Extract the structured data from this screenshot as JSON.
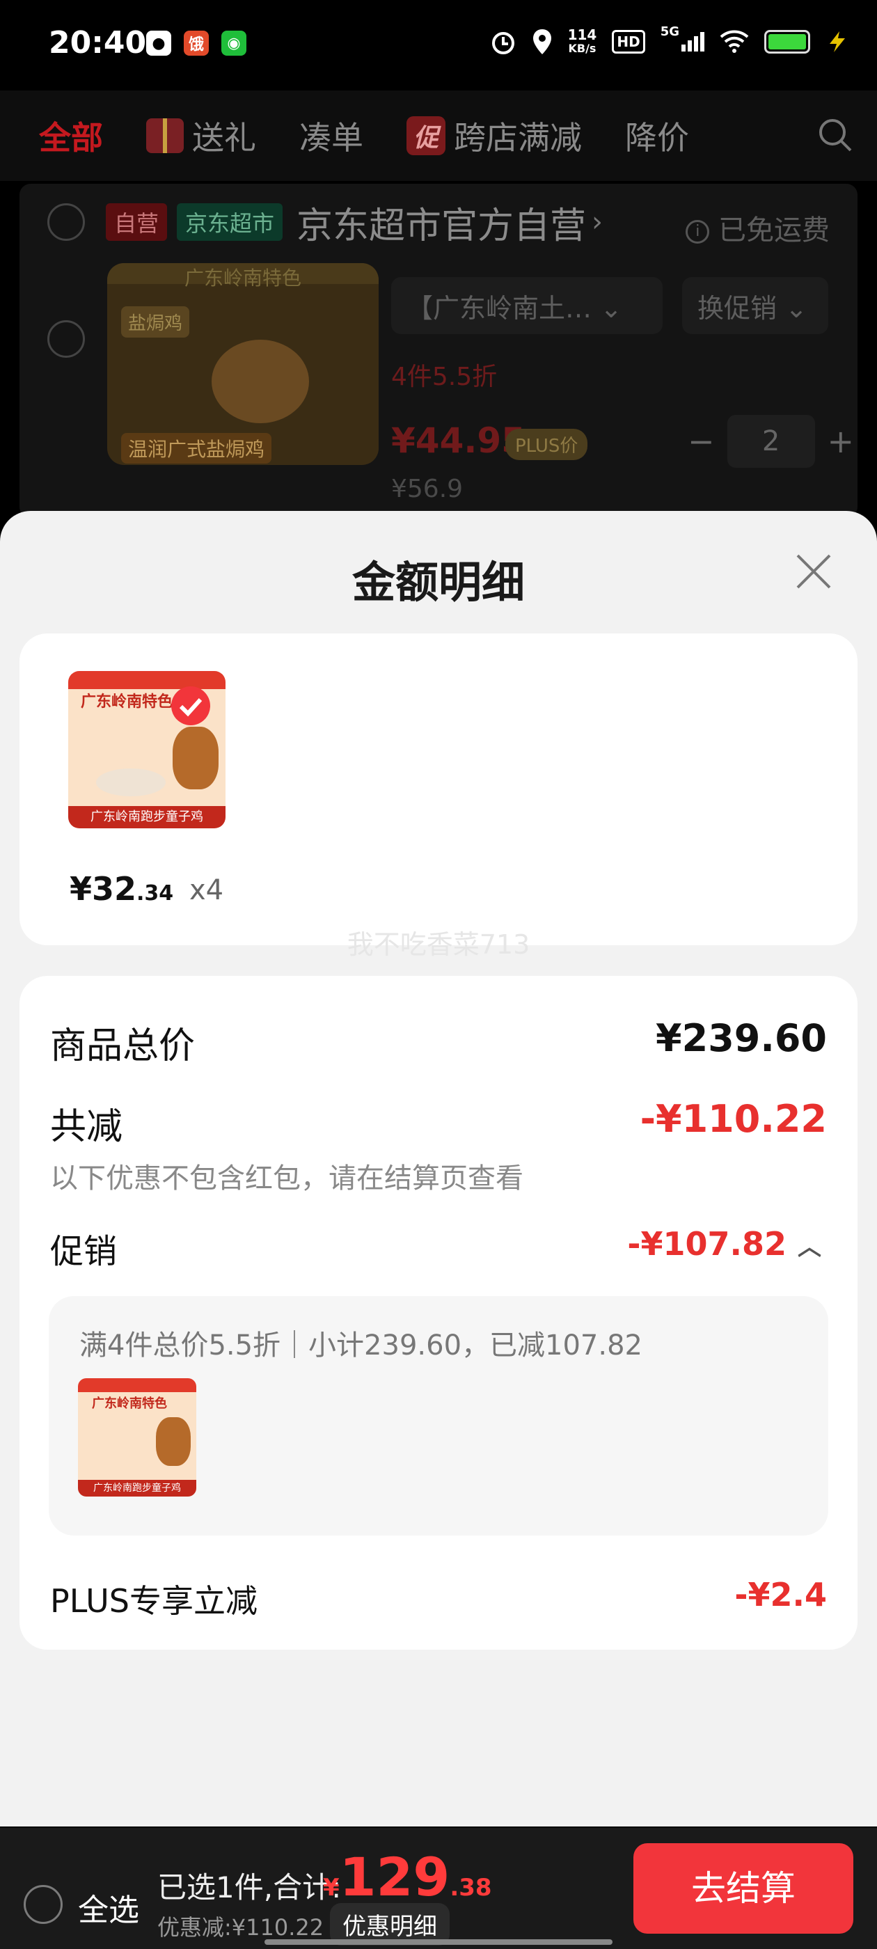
{
  "status_bar": {
    "time": "20:40",
    "speed_value": "114",
    "speed_unit": "KB/s",
    "hd": "HD",
    "network": "5G"
  },
  "tabs": [
    {
      "label": "全部",
      "active": true
    },
    {
      "label": "送礼"
    },
    {
      "label": "凑单"
    },
    {
      "label": "跨店满减",
      "badge": "促"
    },
    {
      "label": "降价"
    }
  ],
  "cart": {
    "tag_self": "自营",
    "tag_market": "京东超市",
    "store_name": "京东超市官方自营",
    "free_shipping": "已免运费",
    "image_header": "广东岭南特色",
    "image_tag": "盐焗鸡",
    "image_caption": "温润广式盐焗鸡",
    "promo_select": "【广东岭南土…",
    "promo_button": "换促销",
    "discount": "4件5.5折",
    "price": "¥44.95",
    "plus_badge": "PLUS价",
    "orig_price": "¥56.9",
    "qty": "2"
  },
  "sheet": {
    "title": "金额明细",
    "item_price_main": "¥32",
    "item_price_decimal": ".34",
    "item_count": "x4",
    "thumb_header": "广东岭南特色",
    "thumb_caption": "广东岭南跑步童子鸡",
    "watermark": "我不吃香菜713",
    "goods_total_label": "商品总价",
    "goods_total_value": "¥239.60",
    "reduction_label": "共减",
    "reduction_value": "-¥110.22",
    "reduction_note": "以下优惠不包含红包，请在结算页查看",
    "promo_label": "促销",
    "promo_value": "-¥107.82",
    "promo_detail": "满4件总价5.5折｜小计239.60，已减107.82",
    "plus_label": "PLUS专享立减",
    "plus_value": "-¥2.4"
  },
  "bottom_bar": {
    "select_all": "全选",
    "summary": "已选1件,合计:",
    "currency": "¥",
    "total_main": "129",
    "total_decimal": ".38",
    "saved": "优惠减:¥110.22",
    "detail_link": "优惠明细",
    "checkout": "去结算"
  },
  "colors": {
    "accent_red": "#f2353b",
    "discount_red": "#e8302e",
    "sheet_bg": "#f2f2f2"
  }
}
